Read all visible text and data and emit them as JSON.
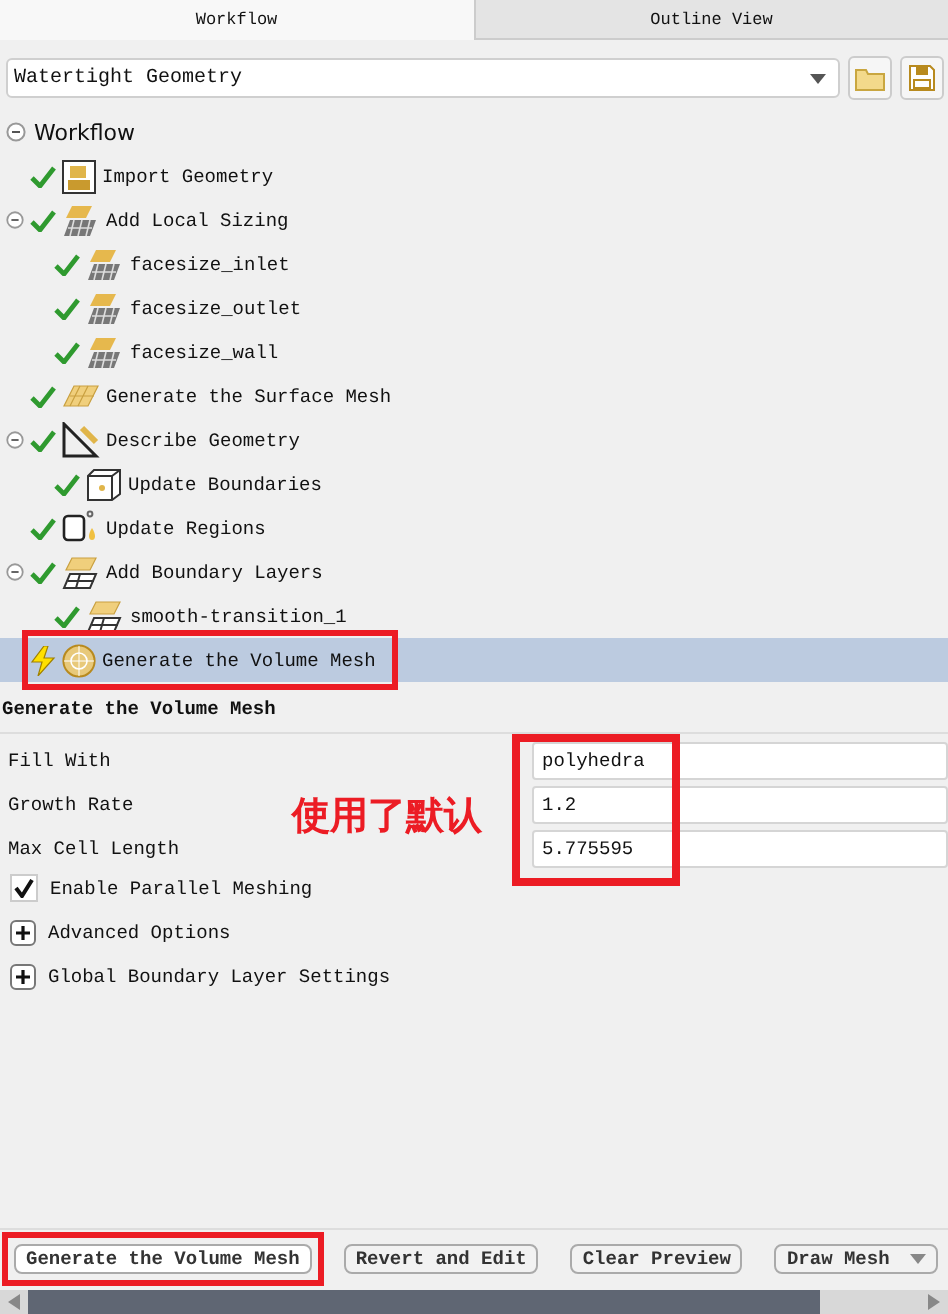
{
  "tabs": [
    {
      "label": "Workflow",
      "selected": true
    },
    {
      "label": "Outline View",
      "selected": false
    }
  ],
  "workflow_select": {
    "value": "Watertight Geometry"
  },
  "tree": {
    "label": "Workflow",
    "expanded": true,
    "children": [
      {
        "label": "Import Geometry",
        "done": true,
        "kind": "import",
        "selected": false,
        "highlighted": false
      },
      {
        "label": "Add Local Sizing",
        "done": true,
        "kind": "sizing",
        "expanded": true,
        "selected": false,
        "highlighted": false,
        "children": [
          {
            "label": "facesize_inlet",
            "done": true,
            "kind": "sizing",
            "selected": false,
            "highlighted": false
          },
          {
            "label": "facesize_outlet",
            "done": true,
            "kind": "sizing",
            "selected": false,
            "highlighted": false
          },
          {
            "label": "facesize_wall",
            "done": true,
            "kind": "sizing",
            "selected": false,
            "highlighted": false
          }
        ]
      },
      {
        "label": "Generate the Surface Mesh",
        "done": true,
        "kind": "surface",
        "selected": false,
        "highlighted": false
      },
      {
        "label": "Describe Geometry",
        "done": true,
        "kind": "describe",
        "expanded": true,
        "selected": false,
        "highlighted": false,
        "children": [
          {
            "label": "Update Boundaries",
            "done": true,
            "kind": "boundaries",
            "selected": false,
            "highlighted": false
          }
        ]
      },
      {
        "label": "Update Regions",
        "done": true,
        "kind": "regions",
        "selected": false,
        "highlighted": false
      },
      {
        "label": "Add Boundary Layers",
        "done": true,
        "kind": "layers",
        "expanded": true,
        "selected": false,
        "highlighted": false,
        "children": [
          {
            "label": "smooth-transition_1",
            "done": true,
            "kind": "layers",
            "selected": false,
            "highlighted": false
          }
        ]
      },
      {
        "label": "Generate the Volume Mesh",
        "done": false,
        "kind": "volume",
        "selected": true,
        "highlighted": true
      }
    ]
  },
  "panel": {
    "title": "Generate the Volume Mesh",
    "fields_highlighted": true,
    "fields": [
      {
        "label": "Fill With",
        "value": "polyhedra"
      },
      {
        "label": "Growth Rate",
        "value": "1.2"
      },
      {
        "label": "Max Cell Length",
        "value": "5.775595"
      }
    ],
    "annotation": "使用了默认",
    "checkbox": {
      "label": "Enable Parallel Meshing",
      "checked": true
    },
    "sections": [
      {
        "label": "Advanced Options",
        "expanded": false
      },
      {
        "label": "Global Boundary Layer Settings",
        "expanded": false
      }
    ]
  },
  "buttons": [
    {
      "label": "Generate the Volume Mesh",
      "highlighted": true,
      "kind": "plain"
    },
    {
      "label": "Revert and Edit",
      "highlighted": false,
      "kind": "plain"
    },
    {
      "label": "Clear Preview",
      "highlighted": false,
      "kind": "plain"
    },
    {
      "label": "Draw Mesh",
      "highlighted": false,
      "kind": "menu"
    }
  ]
}
